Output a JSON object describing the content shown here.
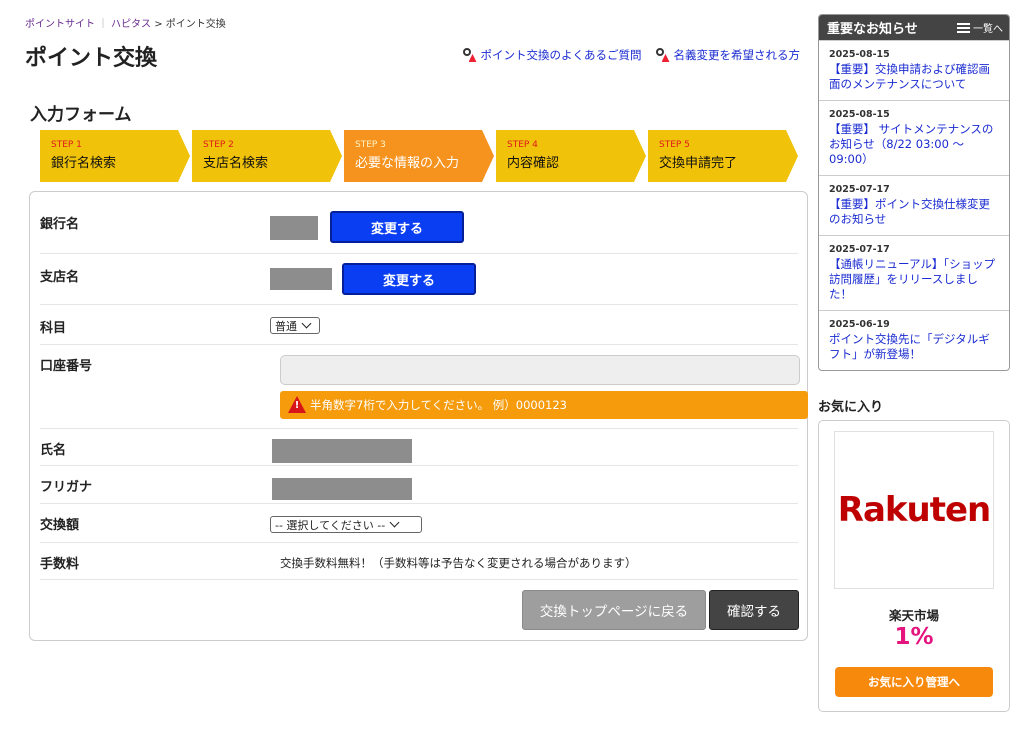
{
  "breadcrumb": {
    "items": [
      "ポイントサイト",
      "ハピタス"
    ],
    "separator": "｜",
    "arrow": ">",
    "current": "ポイント交換"
  },
  "page_title": "ポイント交換",
  "help_links": [
    {
      "label": "ポイント交換のよくあるご質問",
      "icon": "key-icon"
    },
    {
      "label": "名義変更を希望される方",
      "icon": "key-icon"
    }
  ],
  "form_heading": "入力フォーム",
  "steps": [
    {
      "num": "STEP 1",
      "label": "銀行名検索",
      "active": false
    },
    {
      "num": "STEP 2",
      "label": "支店名検索",
      "active": false
    },
    {
      "num": "STEP 3",
      "label": "必要な情報の入力",
      "active": true
    },
    {
      "num": "STEP 4",
      "label": "内容確認",
      "active": false
    },
    {
      "num": "STEP 5",
      "label": "交換申請完了",
      "active": false
    }
  ],
  "form": {
    "bank_label": "銀行名",
    "bank_change": "変更する",
    "branch_label": "支店名",
    "branch_change": "変更する",
    "account_type_label": "科目",
    "account_type_value": "普通",
    "account_number_label": "口座番号",
    "account_number_value": "",
    "account_number_warning": "半角数字7桁で入力してください。 例）0000123",
    "name_label": "氏名",
    "kana_label": "フリガナ",
    "amount_label": "交換額",
    "amount_placeholder": "-- 選択してください --",
    "fee_label": "手数料",
    "fee_text": "交換手数料無料！（手数料等は予告なく変更される場合があります）",
    "back_button": "交換トップページに戻る",
    "confirm_button": "確認する"
  },
  "notices": {
    "title": "重要なお知らせ",
    "view_all": "一覧へ",
    "items": [
      {
        "date": "2025-08-15",
        "text": "【重要】交換申請および確認画面のメンテナンスについて"
      },
      {
        "date": "2025-08-15",
        "text": "【重要】 サイトメンテナンスのお知らせ（8/22 03:00 〜 09:00）"
      },
      {
        "date": "2025-07-17",
        "text": "【重要】ポイント交換仕様変更のお知らせ"
      },
      {
        "date": "2025-07-17",
        "text": "【通帳リニューアル】「ショップ訪問履歴」をリリースしました！"
      },
      {
        "date": "2025-06-19",
        "text": "ポイント交換先に「デジタルギフト」が新登場！"
      }
    ]
  },
  "favorites": {
    "title": "お気に入り",
    "logo_text": "Rakuten",
    "shop_name": "楽天市場",
    "rate": "1%",
    "manage_button": "お気に入り管理へ"
  },
  "colors": {
    "step": "#f0c20a",
    "step_active": "#f5931e",
    "change_button": "#0a3ef2",
    "warning": "#f59b0c",
    "link": "#1a2bd1",
    "rate": "#e4137d",
    "fav_button": "#f7890d"
  }
}
